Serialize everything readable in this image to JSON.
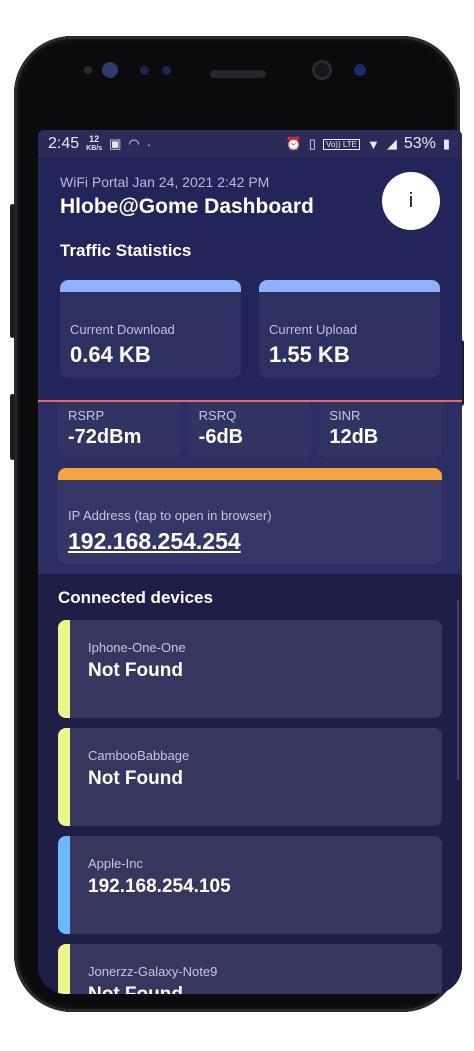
{
  "status_bar": {
    "time": "2:45",
    "speed_value": "12",
    "speed_unit": "KB/s",
    "icons_left": [
      "image-icon",
      "wifi-icon",
      "dot-icon"
    ],
    "icons_right": [
      "alarm-icon",
      "vibrate-icon",
      "volte-icon",
      "wifi-x-icon",
      "signal-icon",
      "battery-icon"
    ],
    "volte_label": "Vo)) LTE",
    "battery_percent": "53%"
  },
  "header": {
    "subtitle": "WiFi Portal Jan 24, 2021 2:42 PM",
    "title": "Hlobe@Gome Dashboard",
    "info_label": "i"
  },
  "traffic": {
    "section_title": "Traffic Statistics",
    "cards": [
      {
        "label": "Current Download",
        "value": "0.64 KB"
      },
      {
        "label": "Current Upload",
        "value": "1.55 KB"
      }
    ]
  },
  "signal": [
    {
      "label": "RSRP",
      "value": "-72dBm"
    },
    {
      "label": "RSRQ",
      "value": "-6dB"
    },
    {
      "label": "SINR",
      "value": "12dB"
    }
  ],
  "ip": {
    "label": "IP Address (tap to open in browser)",
    "value": "192.168.254.254"
  },
  "devices": {
    "section_title": "Connected devices",
    "items": [
      {
        "name": "Iphone-One-One",
        "status": "Not Found"
      },
      {
        "name": "CambooBabbage",
        "status": "Not Found"
      },
      {
        "name": "Apple-Inc",
        "status": "192.168.254.105"
      },
      {
        "name": "Jonerzz-Galaxy-Note9",
        "status": "Not Found"
      }
    ]
  },
  "colors": {
    "background": "#1e1f47",
    "download_band": "#8fb1ff",
    "ip_band": "#f5a340",
    "not_found_bar": "#eef58a",
    "found_bar": "#6fb6ff",
    "divider": "#e06a6a"
  }
}
